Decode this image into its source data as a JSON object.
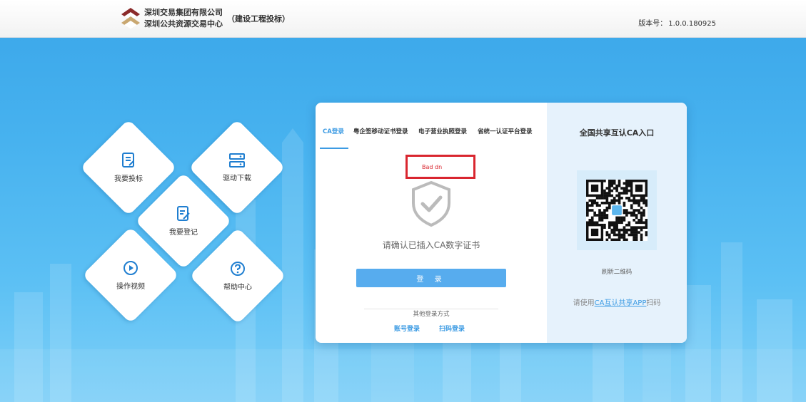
{
  "header": {
    "org_line1": "深圳交易集团有限公司",
    "org_line2": "深圳公共资源交易中心",
    "subtitle": "（建设工程投标）",
    "version_label": "版本号：",
    "version_value": "1.0.0.180925"
  },
  "tiles": {
    "bid": "我要投标",
    "driver": "驱动下载",
    "register": "我要登记",
    "video": "操作视频",
    "help": "帮助中心"
  },
  "login": {
    "tabs": [
      "CA登录",
      "粤企签移动证书登录",
      "电子营业执照登录",
      "省统一认证平台登录"
    ],
    "error": "Bad dn",
    "prompt": "请确认已插入CA数字证书",
    "login_button": "登 录",
    "other_methods": "其他登录方式",
    "alt_account": "账号登录",
    "alt_scan": "扫码登录"
  },
  "ca": {
    "title": "全国共享互认CA入口",
    "refresh": "刷新二维码",
    "scan_prefix": "请使用",
    "scan_link": "CA互认共享APP",
    "scan_suffix": "扫码"
  },
  "colors": {
    "accent": "#3c9be3",
    "button": "#57acee",
    "error": "#d9262f"
  },
  "icons": [
    "logo-icon",
    "bid-doc-icon",
    "server-icon",
    "register-edit-icon",
    "play-icon",
    "question-icon",
    "shield-check-icon",
    "qr-code-icon"
  ]
}
